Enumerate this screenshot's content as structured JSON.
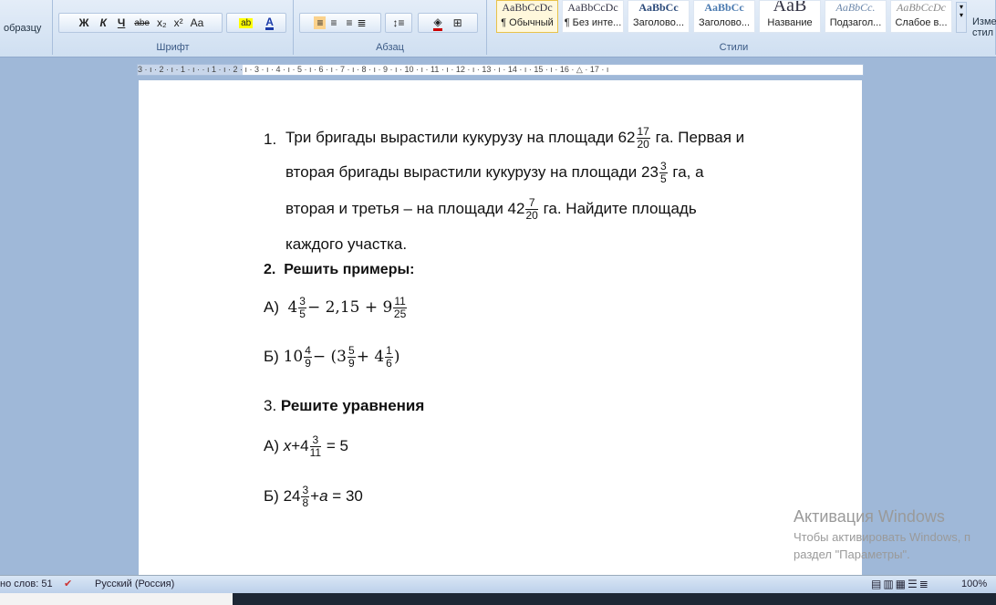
{
  "ribbon": {
    "clipboard_label": "образцу",
    "font_group": "Шрифт",
    "paragraph_group": "Абзац",
    "styles_group": "Стили",
    "font_buttons": [
      "Ж",
      "К",
      "Ч",
      "abe",
      "x₂",
      "x²",
      "Aa"
    ],
    "styles": [
      {
        "sample": "AaBbCcDc",
        "label": "¶ Обычный"
      },
      {
        "sample": "AaBbCcDc",
        "label": "¶ Без инте..."
      },
      {
        "sample": "AaBbCc",
        "label": "Заголово..."
      },
      {
        "sample": "AaBbCc",
        "label": "Заголово..."
      },
      {
        "sample": "AaB",
        "label": "Название"
      },
      {
        "sample": "AaBbCc.",
        "label": "Подзагол..."
      },
      {
        "sample": "AaBbCcDc",
        "label": "Слабое в..."
      }
    ],
    "change_styles": "Изме стил"
  },
  "ruler": "3 · ı · 2 · ı · 1 · ı ·      · ı 1 · ı · 2 · ı · 3 · ı · 4 · ı · 5 · ı · 6 · ı · 7 · ı · 8 · ı · 9 · ı · 10 · ı · 11 · ı · 12 · ı · 13 · ı · 14 · ı · 15 · ı · 16 · △ · 17 · ı",
  "doc": {
    "p1": {
      "num": "1.",
      "l1a": "Три бригады вырастили кукурузу на площади 62",
      "f1n": "17",
      "f1d": "20",
      "l1b": " га. Первая и",
      "l2a": "вторая бригады вырастили кукурузу на площади 23",
      "f2n": "3",
      "f2d": "5",
      "l2b": " га, а",
      "l3a": "вторая  и третья – на площади 42",
      "f3n": "7",
      "f3d": "20",
      "l3b": " га. Найдите площадь",
      "l4": "каждого участка."
    },
    "p2": {
      "num": "2.",
      "title": "Решить примеры:"
    },
    "a": {
      "label": "А)",
      "w1": "4",
      "f1n": "3",
      "f1d": "5",
      "mid": "−  2,15 + 9",
      "f2n": "11",
      "f2d": "25"
    },
    "b": {
      "label": "Б)",
      "w1": "10",
      "f1n": "4",
      "f1d": "9",
      "mid": "−  (3",
      "f2n": "5",
      "f2d": "9",
      "mid2": "+ 4",
      "f3n": "1",
      "f3d": "6",
      "end": ")"
    },
    "p3": {
      "num": "3.",
      "title": "Решите уравнения"
    },
    "e1": {
      "label": "А)",
      "x": "x",
      "pre": "+4",
      "fn": "3",
      "fd": "11",
      "post": " = 5"
    },
    "e2": {
      "label": "Б)",
      "pre": "24",
      "fn": "3",
      "fd": "8",
      "plus": "+",
      "a": "a",
      "post": " = 30"
    }
  },
  "watermark": {
    "title": "Активация Windows",
    "line1": "Чтобы активировать Windows, п",
    "line2": "раздел \"Параметры\"."
  },
  "status": {
    "words": "но слов: 51",
    "language": "Русский (Россия)",
    "zoom": "100%"
  }
}
